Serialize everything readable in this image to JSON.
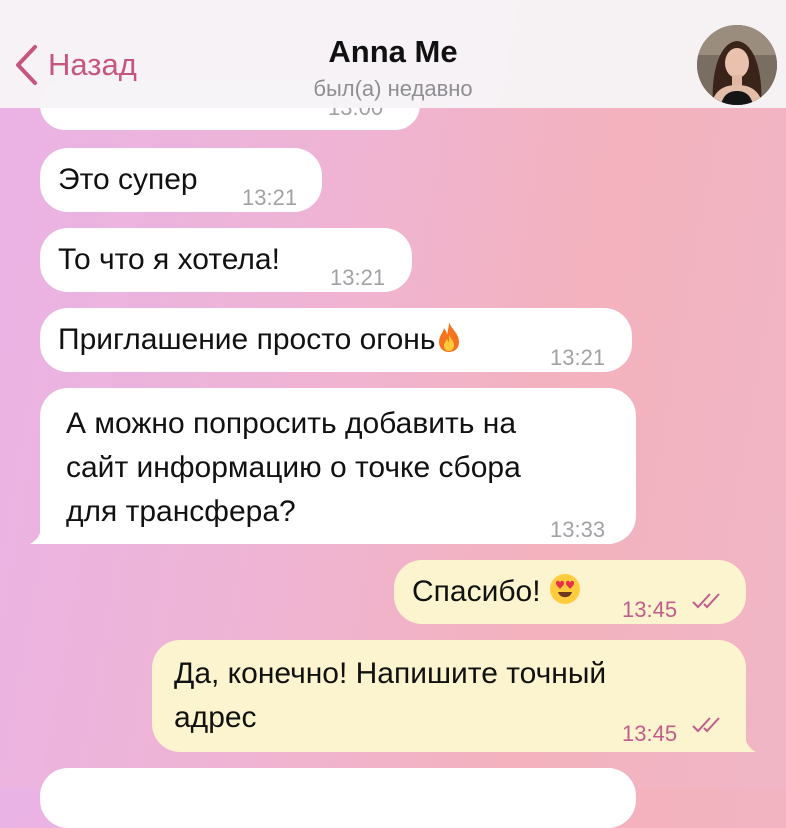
{
  "header": {
    "back_label": "Назад",
    "contact_name": "Anna Me",
    "status": "был(а) недавно"
  },
  "messages": [
    {
      "text": "",
      "time": "13:00"
    },
    {
      "text": "Это супер",
      "time": "13:21"
    },
    {
      "text": "То что я хотела!",
      "time": "13:21"
    },
    {
      "text": "Приглашение просто огонь",
      "time": "13:21",
      "emoji": "fire"
    },
    {
      "lines": [
        "А можно попросить добавить на",
        "сайт информацию о точке сбора",
        "для трансфера?"
      ],
      "time": "13:33"
    },
    {
      "text": "Спасибо!",
      "time": "13:45",
      "emoji": "heart-eyes",
      "read": true
    },
    {
      "lines": [
        "Да, конечно! Напишите точный",
        "адрес"
      ],
      "time": "13:45",
      "read": true
    }
  ],
  "colors": {
    "accent": "#c7567e",
    "incoming_bubble": "#ffffff",
    "outgoing_bubble": "#fbf4cf",
    "outgoing_time": "#c25d8b"
  }
}
